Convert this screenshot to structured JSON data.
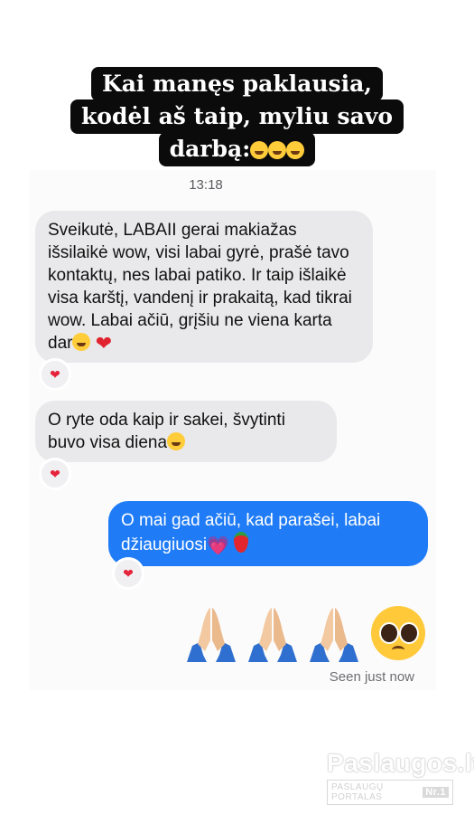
{
  "caption": {
    "lines": [
      "Kai manęs paklausia,",
      "kodėl aš taip, myliu savo",
      "darbą:"
    ],
    "emoji_count": 3
  },
  "chat": {
    "timestamp": "13:18",
    "messages": [
      {
        "direction": "incoming",
        "text": "Sveikutė, LABAII gerai makiažas išsilaikė wow, visi labai gyrė, prašė tavo kontaktų, nes labai patiko. Ir taip išlaikė visa karštį, vandenį ir prakaitą, kad tikrai wow. Labai ačiū, grįšiu ne viena karta dar",
        "emojis": [
          "grinning-sweat-icon",
          "red-heart-icon"
        ],
        "reaction": "red-heart-icon"
      },
      {
        "direction": "incoming",
        "text": "O ryte oda kaip ir sakei, švytinti buvo visa diena",
        "emojis": [
          "grinning-sweat-icon"
        ],
        "reaction": "red-heart-icon"
      },
      {
        "direction": "outgoing",
        "text": "O mai gad ačiū, kad parašei, labai džiaugiuosi",
        "emojis": [
          "sparkling-heart-icon",
          "strawberry-icon"
        ],
        "reaction": "red-heart-icon"
      }
    ],
    "emoji_message": [
      "folded-hands-icon",
      "folded-hands-icon",
      "folded-hands-icon",
      "pleading-face-icon"
    ],
    "seen_status": "Seen just now"
  },
  "watermark": {
    "title": "Paslaugos.lt",
    "subtitle": "PASLAUGŲ PORTALAS",
    "badge": "Nr.1"
  },
  "colors": {
    "incoming_bubble": "#e9e9eb",
    "outgoing_bubble": "#1f7cf6",
    "reaction_heart": "#e5243b",
    "caption_bg": "#0b0b0b"
  }
}
